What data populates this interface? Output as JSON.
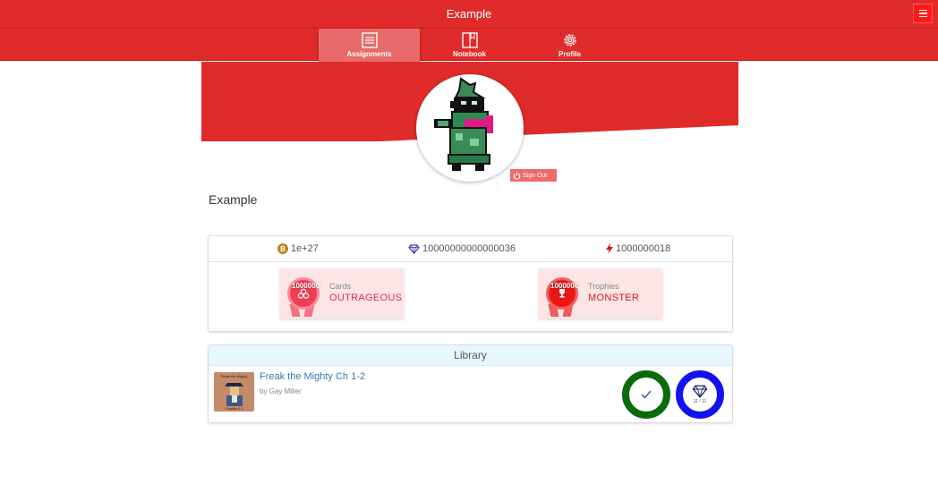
{
  "app": {
    "title": "Example"
  },
  "header": {
    "menu_icon": "hamburger-icon"
  },
  "nav": {
    "items": [
      {
        "label": "Assignments",
        "icon": "list-icon",
        "active": true
      },
      {
        "label": "Notebook",
        "icon": "book-icon",
        "active": false
      },
      {
        "label": "Profile",
        "icon": "gear-icon",
        "active": false
      }
    ]
  },
  "profile": {
    "name": "Example",
    "signout_label": "Sign Out",
    "avatar_icon": "pixel-character-avatar"
  },
  "stats": {
    "coins": "1e+27",
    "gems": "10000000000000036",
    "energy": "1000000018"
  },
  "badges": [
    {
      "number": "1000000",
      "label": "Cards",
      "title": "OUTRAGEOUS",
      "icon": "cards-icon"
    },
    {
      "number": "1000000",
      "label": "Trophies",
      "title": "MONSTER",
      "icon": "trophy-icon"
    }
  ],
  "library": {
    "heading": "Library",
    "books": [
      {
        "title": "Freak the Mighty Ch 1-2",
        "author": "by Gay Miller",
        "cover_text": "Freak the Mighty",
        "cover_subtext": "Chapters 1-2",
        "progress_text": "11 / 11",
        "status": "check-icon"
      }
    ]
  },
  "colors": {
    "brand_red": "#e02b2b",
    "complete_green": "#0b6b0b",
    "gem_blue": "#1212ee"
  }
}
